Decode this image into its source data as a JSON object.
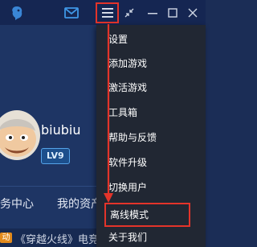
{
  "icons": {
    "logo": "bird-logo-icon",
    "mail": "mail-icon",
    "menu": "hamburger-menu-icon",
    "shrink": "shrink-icon",
    "minimize": "minimize-icon",
    "maximize": "maximize-icon",
    "close": "close-icon",
    "add": "plus-icon"
  },
  "colors": {
    "titlebar": "#152652",
    "background": "#1e3564",
    "menu": "#212733",
    "annotation": "#e3342a",
    "level_badge": "#1c4f8c"
  },
  "profile": {
    "username": "biubiu",
    "level": "LV9"
  },
  "nav": {
    "items": [
      "务中心",
      "我的资产"
    ]
  },
  "news": {
    "tag": "动",
    "text": "《穿越火线》电竞赛"
  },
  "menu": {
    "items": [
      "设置",
      "添加游戏",
      "激活游戏",
      "工具箱",
      "帮助与反馈",
      "软件升级",
      "切换用户",
      "离线模式",
      "关于我们"
    ],
    "highlighted": "离线模式"
  }
}
